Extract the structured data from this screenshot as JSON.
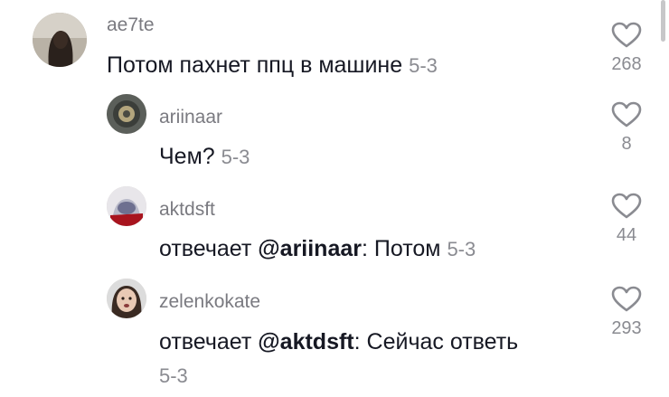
{
  "comments": [
    {
      "username": "ae7te",
      "text": "Потом пахнет ппц в машине",
      "date": "5-3",
      "likes": "268",
      "avatar_icon": "avatar-girl-dark-hair"
    },
    {
      "username": "ariinaar",
      "text": "Чем?",
      "date": "5-3",
      "likes": "8",
      "avatar_icon": "avatar-round-emblem"
    },
    {
      "username": "aktdsft",
      "prefix": "отвечает ",
      "mention": "@ariinaar",
      "text_after": ": Потом",
      "date": "5-3",
      "likes": "44",
      "avatar_icon": "avatar-helmet-red"
    },
    {
      "username": "zelenkokate",
      "prefix": "отвечает ",
      "mention": "@aktdsft",
      "text_after": ": Сейчас ответь",
      "date": "5-3",
      "likes": "293",
      "avatar_icon": "avatar-girl-face"
    }
  ]
}
